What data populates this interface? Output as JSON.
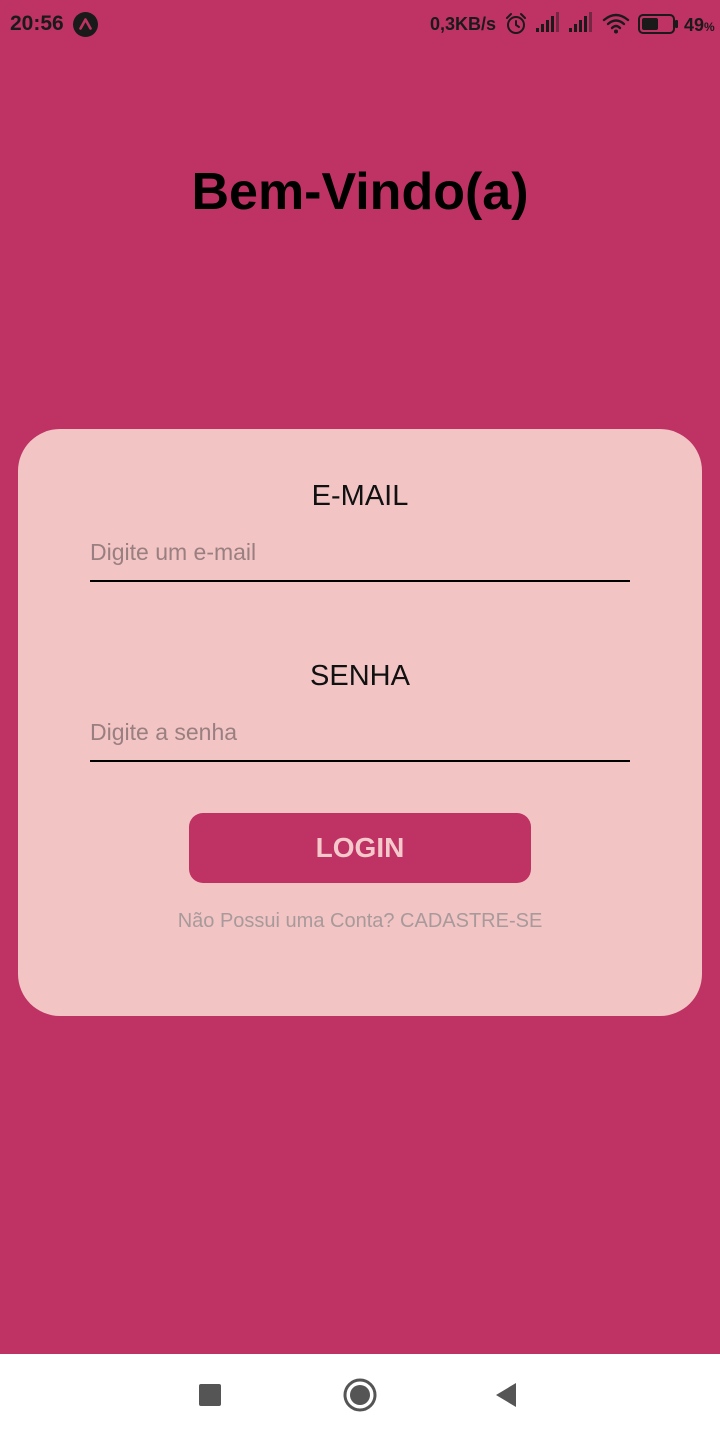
{
  "status_bar": {
    "time": "20:56",
    "network_speed": "0,3KB/s",
    "battery_level": "49",
    "battery_unit": "%",
    "icons": [
      "app-notification-icon",
      "alarm-icon",
      "signal-icon",
      "signal-icon",
      "wifi-icon",
      "battery-icon"
    ]
  },
  "header": {
    "title": "Bem-Vindo(a)"
  },
  "login_form": {
    "email_label": "E-MAIL",
    "email_placeholder": "Digite um e-mail",
    "password_label": "SENHA",
    "password_placeholder": "Digite a senha",
    "login_button": "LOGIN",
    "signup_link": "Não Possui uma Conta? CADASTRE-SE"
  },
  "nav_bar": {
    "icons": [
      "recents-icon",
      "home-icon",
      "back-icon"
    ]
  },
  "colors": {
    "background": "#BE3264",
    "card": "#F2C4C4",
    "button": "#BE3264",
    "button_text": "#F5C9CC"
  }
}
